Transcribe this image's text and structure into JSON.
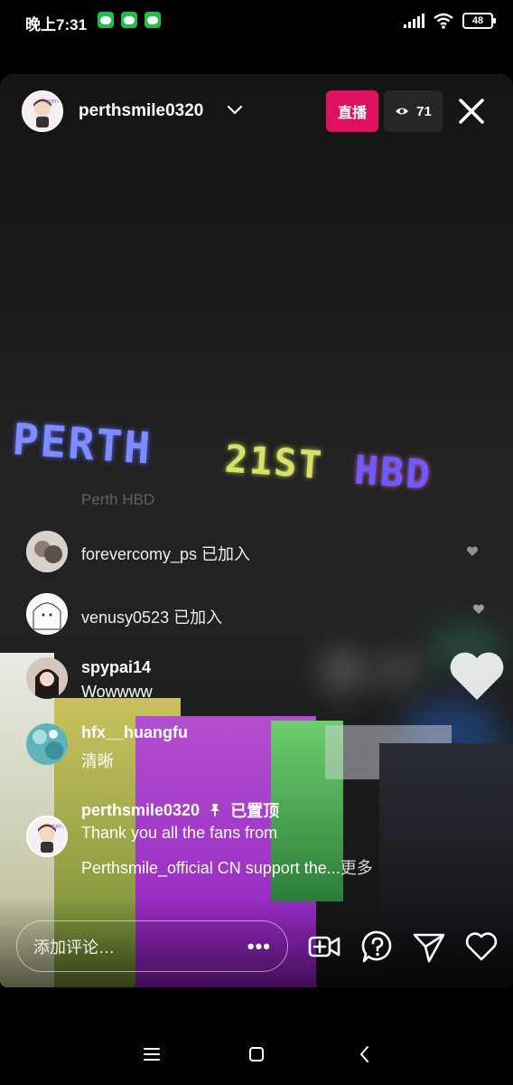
{
  "status_bar": {
    "time": "晚上7:31",
    "notification_icons": [
      "wechat-icon",
      "wechat-icon",
      "wechat-icon"
    ],
    "battery": "48"
  },
  "header": {
    "username": "perthsmile0320",
    "live_label": "直播",
    "viewer_count": "71"
  },
  "stream": {
    "drone_words": [
      "PERTH",
      "21ST",
      "HBD"
    ]
  },
  "comments": {
    "faded_text": "Perth HBD",
    "joins": [
      {
        "text": "forevercomy_ps 已加入"
      },
      {
        "text": "venusy0523 已加入"
      }
    ],
    "messages": [
      {
        "user": "spypai14",
        "text": "Wowwww"
      },
      {
        "user": "hfx__huangfu",
        "text": "清晰"
      }
    ],
    "pinned": {
      "user": "perthsmile0320",
      "pin_label": "已置顶",
      "line1": "Thank you all the fans from",
      "line2": "Perthsmile_official CN support the...",
      "more": "更多"
    }
  },
  "bottom_bar": {
    "placeholder": "添加评论…",
    "more_dots": "•••"
  },
  "colors": {
    "live_badge": "#e0115f",
    "background": "#000000"
  }
}
